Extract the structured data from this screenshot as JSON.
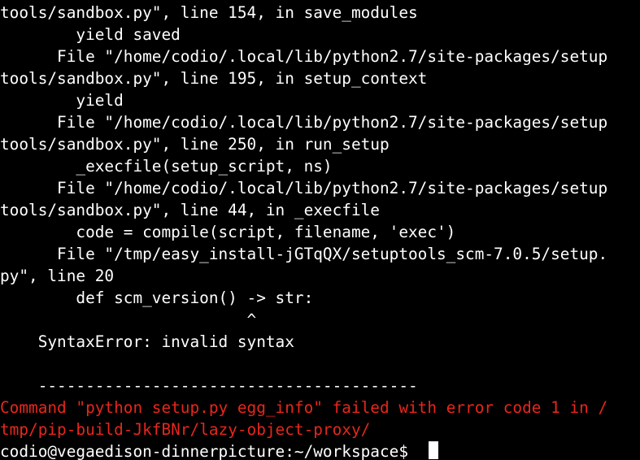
{
  "terminal": {
    "lines": [
      "tools/sandbox.py\", line 154, in save_modules",
      "        yield saved",
      "      File \"/home/codio/.local/lib/python2.7/site-packages/setup",
      "tools/sandbox.py\", line 195, in setup_context",
      "        yield",
      "      File \"/home/codio/.local/lib/python2.7/site-packages/setup",
      "tools/sandbox.py\", line 250, in run_setup",
      "        _execfile(setup_script, ns)",
      "      File \"/home/codio/.local/lib/python2.7/site-packages/setup",
      "tools/sandbox.py\", line 44, in _execfile",
      "        code = compile(script, filename, 'exec')",
      "      File \"/tmp/easy_install-jGTqQX/setuptools_scm-7.0.5/setup.",
      "py\", line 20",
      "        def scm_version() -> str:",
      "                          ^",
      "    SyntaxError: invalid syntax",
      "",
      "    ----------------------------------------",
      "Command \"python setup.py egg_info\" failed with error code 1 in /",
      "tmp/pip-build-JkfBNr/lazy-object-proxy/",
      "codio@vegaedison-dinnerpicture:~/workspace$ "
    ],
    "error_color": "#e8261c",
    "text_color": "#ffffff",
    "background_color": "#000000"
  }
}
